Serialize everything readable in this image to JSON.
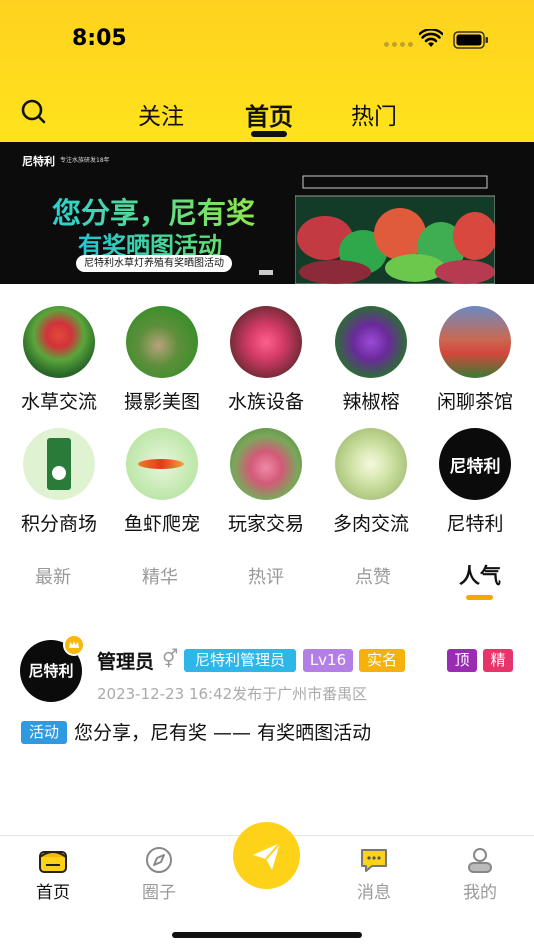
{
  "status_bar": {
    "time": "8:05"
  },
  "header": {
    "tabs": [
      {
        "label": "关注"
      },
      {
        "label": "首页"
      },
      {
        "label": "热门"
      }
    ]
  },
  "banner": {
    "brand": "尼特利",
    "brand_sub": "专注水族研发18年",
    "headline": "您分享，尼有奖",
    "subheadline": "有奖晒图活动",
    "tagline": "尼特利水草灯养殖有奖晒图活动"
  },
  "categories": [
    {
      "label": "水草交流"
    },
    {
      "label": "摄影美图"
    },
    {
      "label": "水族设备"
    },
    {
      "label": "辣椒榕"
    },
    {
      "label": "闲聊茶馆"
    },
    {
      "label": "积分商场"
    },
    {
      "label": "鱼虾爬宠"
    },
    {
      "label": "玩家交易"
    },
    {
      "label": "多肉交流"
    },
    {
      "label": "尼特利"
    }
  ],
  "sort_tabs": [
    {
      "label": "最新"
    },
    {
      "label": "精华"
    },
    {
      "label": "热评"
    },
    {
      "label": "点赞"
    },
    {
      "label": "人气"
    }
  ],
  "post": {
    "avatar_text": "尼特利",
    "username": "管理员",
    "gender_symbol": "⚥",
    "badges": {
      "role": "尼特利管理员",
      "level": "Lv16",
      "verified": "实名",
      "top": "顶",
      "essence": "精"
    },
    "meta": "2023-12-23 16:42发布于广州市番禺区",
    "topic": "活动",
    "title": "您分享，尼有奖 —— 有奖晒图活动"
  },
  "bottom_nav": [
    {
      "label": "首页"
    },
    {
      "label": "圈子"
    },
    {
      "label": "消息"
    },
    {
      "label": "我的"
    }
  ],
  "colors": {
    "header_yellow": "#ffd21f",
    "accent_orange": "#f7a800",
    "badge_role": "#2fb6e8",
    "badge_level": "#b37fe6",
    "badge_verified": "#f6b20a",
    "badge_top": "#9a2bb3",
    "badge_essence": "#e8336b",
    "topic_blue": "#2f9ae0"
  }
}
